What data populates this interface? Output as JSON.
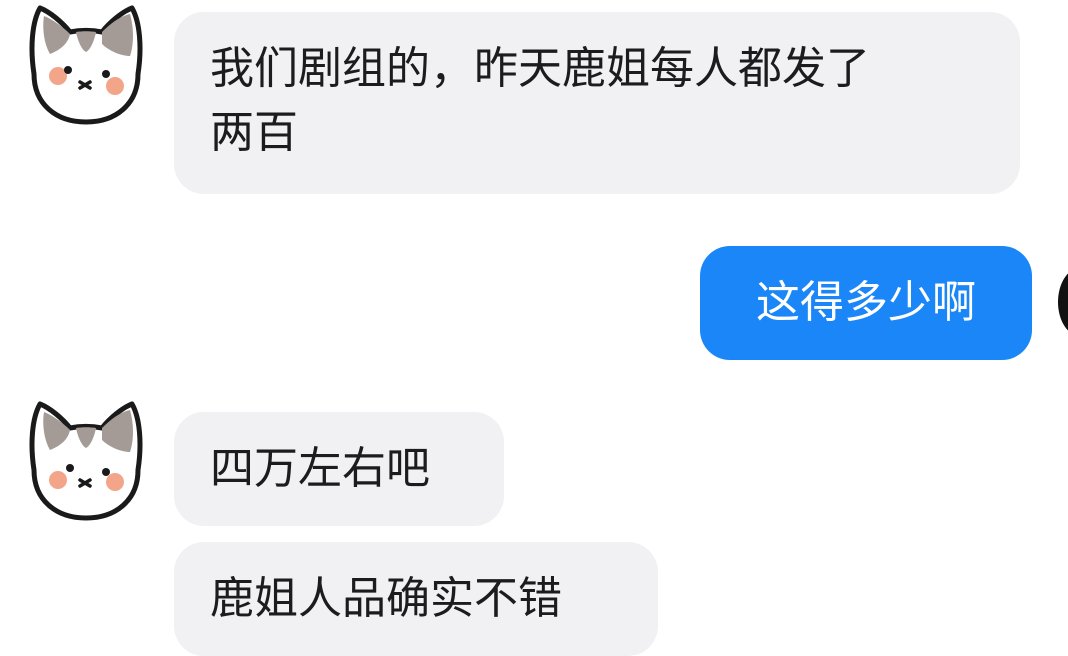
{
  "messages": [
    {
      "sender": "other",
      "avatar": "cat-avatar",
      "lines": [
        "我们剧组的，昨天鹿姐每人都发了",
        "两百"
      ]
    },
    {
      "sender": "self",
      "text": "这得多少啊"
    },
    {
      "sender": "other",
      "avatar": "cat-avatar",
      "text": "四万左右吧"
    },
    {
      "sender": "other",
      "text": "鹿姐人品确实不错"
    }
  ],
  "colors": {
    "incoming_bubble": "#f1f1f3",
    "outgoing_bubble": "#1a86f7",
    "text_dark": "#1c1c1e",
    "text_light": "#ffffff"
  }
}
